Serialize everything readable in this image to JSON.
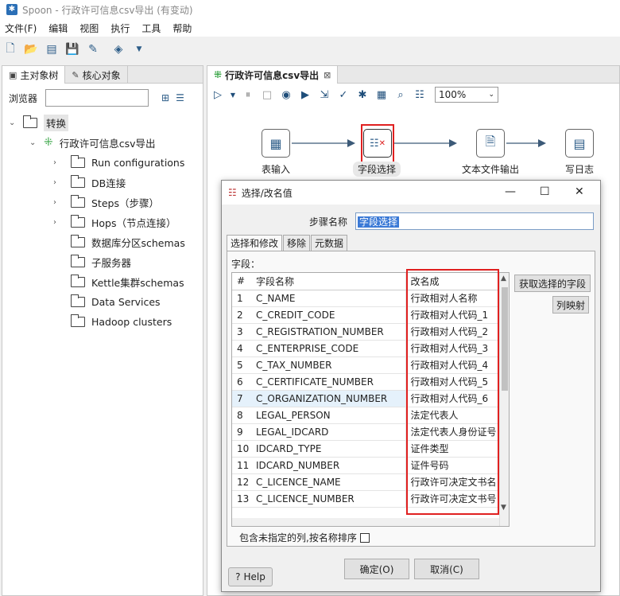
{
  "window": {
    "title": "Spoon - 行政许可信息csv导出 (有变动)"
  },
  "menu": [
    "文件(F)",
    "编辑",
    "视图",
    "执行",
    "工具",
    "帮助"
  ],
  "left": {
    "tabs": [
      "主对象树",
      "核心对象"
    ],
    "browser_label": "浏览器",
    "search_value": "",
    "root": "转换",
    "transform": "行政许可信息csv导出",
    "items": [
      "Run configurations",
      "DB连接",
      "Steps（步骤）",
      "Hops（节点连接）",
      "数据库分区schemas",
      "子服务器",
      "Kettle集群schemas",
      "Data Services",
      "Hadoop clusters"
    ]
  },
  "editor": {
    "tab": "行政许可信息csv导出",
    "zoom": "100%",
    "steps": [
      "表输入",
      "字段选择",
      "文本文件输出",
      "写日志"
    ]
  },
  "dialog": {
    "title": "选择/改名值",
    "step_name_label": "步骤名称",
    "step_name": "字段选择",
    "tabs": [
      "选择和修改",
      "移除",
      "元数据"
    ],
    "fields_label": "字段：",
    "columns": [
      "#",
      "字段名称",
      "改名成"
    ],
    "rows": [
      [
        "1",
        "C_NAME",
        "行政相对人名称"
      ],
      [
        "2",
        "C_CREDIT_CODE",
        "行政相对人代码_1"
      ],
      [
        "3",
        "C_REGISTRATION_NUMBER",
        "行政相对人代码_2"
      ],
      [
        "4",
        "C_ENTERPRISE_CODE",
        "行政相对人代码_3"
      ],
      [
        "5",
        "C_TAX_NUMBER",
        "行政相对人代码_4"
      ],
      [
        "6",
        "C_CERTIFICATE_NUMBER",
        "行政相对人代码_5"
      ],
      [
        "7",
        "C_ORGANIZATION_NUMBER",
        "行政相对人代码_6"
      ],
      [
        "8",
        "LEGAL_PERSON",
        "法定代表人"
      ],
      [
        "9",
        "LEGAL_IDCARD",
        "法定代表人身份证号"
      ],
      [
        "10",
        "IDCARD_TYPE",
        "证件类型"
      ],
      [
        "11",
        "IDCARD_NUMBER",
        "证件号码"
      ],
      [
        "12",
        "C_LICENCE_NAME",
        "行政许可决定文书名"
      ],
      [
        "13",
        "C_LICENCE_NUMBER",
        "行政许可决定文书号"
      ]
    ],
    "get_fields_btn": "获取选择的字段",
    "mapping_btn": "列映射",
    "include_unspecified": "包含未指定的列,按名称排序",
    "help": "Help",
    "ok": "确定(O)",
    "cancel": "取消(C)"
  }
}
